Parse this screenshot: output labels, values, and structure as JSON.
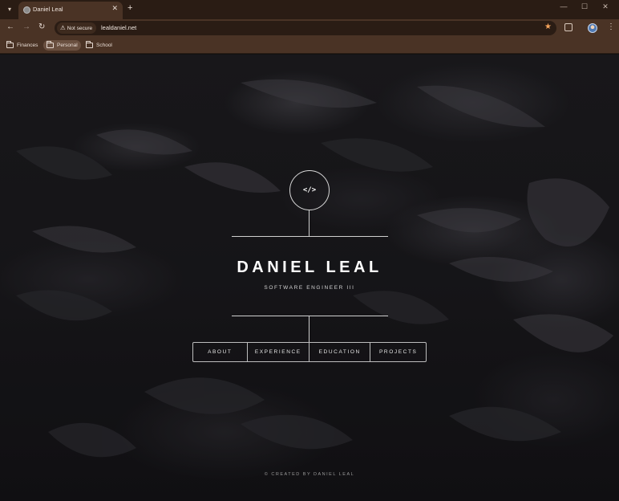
{
  "browser": {
    "tab_title": "Daniel Leal",
    "tab_close": "✕",
    "new_tab": "+",
    "security_label": "Not secure",
    "url": "lealdaniel.net",
    "window_controls": [
      "—",
      "☐",
      "✕"
    ],
    "icons": {
      "tab_search": "chevron-down-icon",
      "back": "arrow-left-icon",
      "forward": "arrow-right-icon",
      "reload": "reload-icon",
      "warning": "warning-triangle-icon",
      "bookmark": "star-icon",
      "extensions": "puzzle-icon",
      "menu": "kebab-icon"
    },
    "bookmarks": [
      "Finances",
      "Personal",
      "School"
    ],
    "colors": {
      "chrome": "#4a3325",
      "tabstrip": "#2a1c14",
      "star": "#f6a45c"
    }
  },
  "site": {
    "logo_glyph": "</>",
    "name": "DANIEL LEAL",
    "subtitle": "SOFTWARE ENGINEER III",
    "nav": [
      "ABOUT",
      "EXPERIENCE",
      "EDUCATION",
      "PROJECTS"
    ],
    "footer": "© CREATED BY DANIEL LEAL"
  }
}
